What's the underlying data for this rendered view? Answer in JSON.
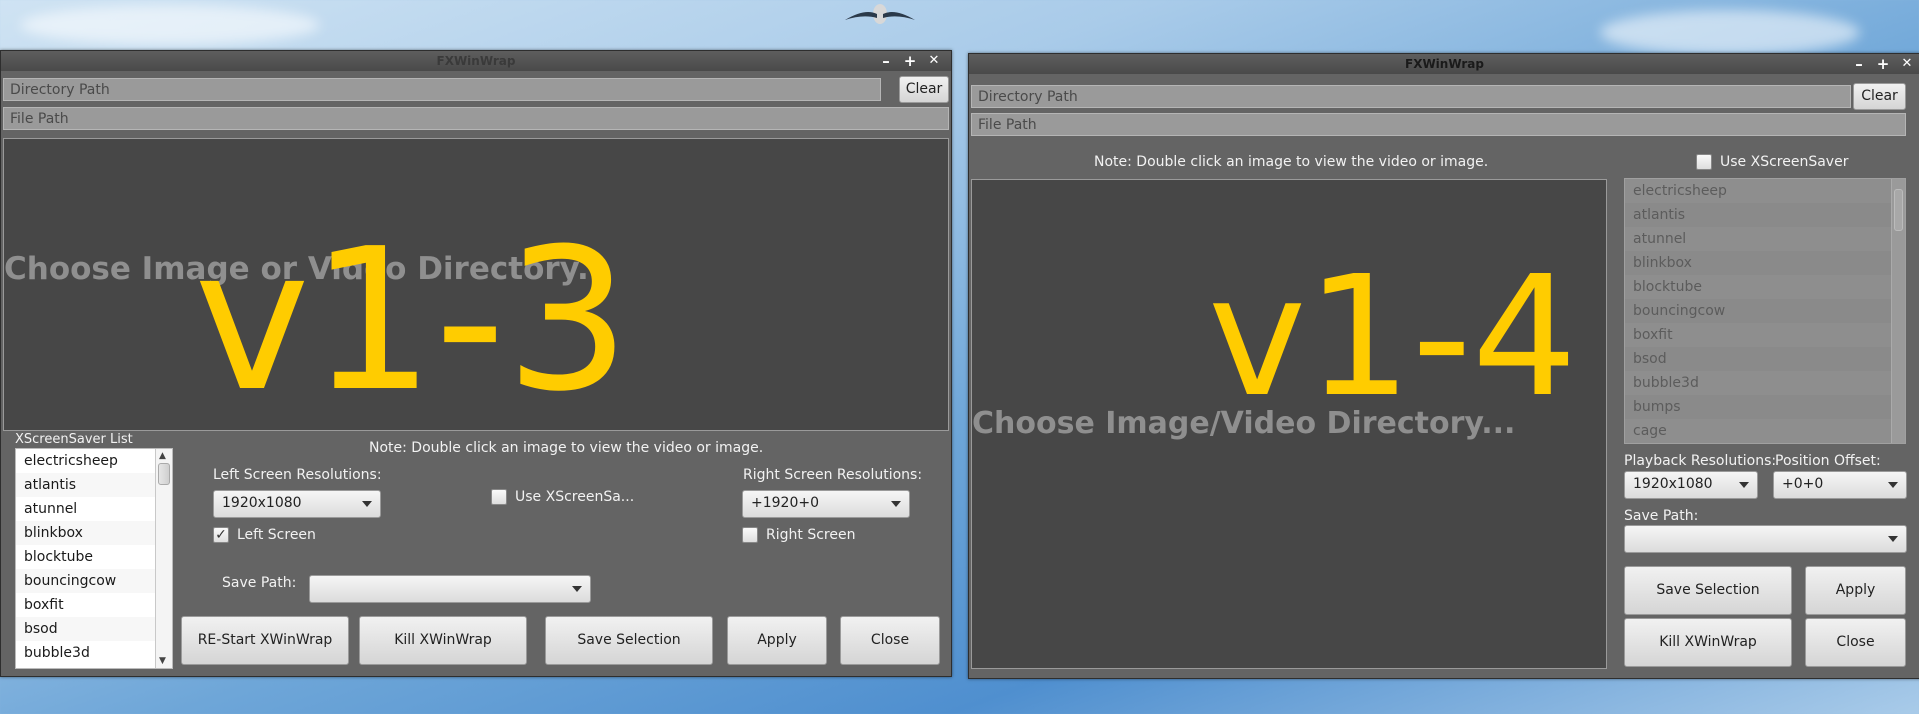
{
  "left_window": {
    "title": "FXWinWrap",
    "version_label": "v1-3",
    "directory_path_placeholder": "Directory Path",
    "file_path_placeholder": "File Path",
    "clear_label": "Clear",
    "preview_placeholder": "Choose Image or Video Directory...",
    "list_title": "XScreenSaver List",
    "note": "Note: Double click an image to view the video or image.",
    "left_res_label": "Left Screen Resolutions:",
    "left_res_value": "1920x1080",
    "use_xscreensaver_label": "Use XScreenSa...",
    "use_xscreensaver_checked": false,
    "right_res_label": "Right Screen Resolutions:",
    "right_res_value": "+1920+0",
    "left_screen_label": "Left Screen",
    "left_screen_checked": true,
    "right_screen_label": "Right Screen",
    "right_screen_checked": false,
    "save_path_label": "Save Path:",
    "save_path_value": "",
    "buttons": {
      "restart": "RE-Start XWinWrap",
      "kill": "Kill XWinWrap",
      "save_selection": "Save Selection",
      "apply": "Apply",
      "close": "Close"
    },
    "screensavers": [
      "electricsheep",
      "atlantis",
      "atunnel",
      "blinkbox",
      "blocktube",
      "bouncingcow",
      "boxfit",
      "bsod",
      "bubble3d"
    ]
  },
  "right_window": {
    "title": "FXWinWrap",
    "version_label": "v1-4",
    "directory_path_placeholder": "Directory Path",
    "file_path_placeholder": "File Path",
    "clear_label": "Clear",
    "note": "Note: Double click an image to view the video or image.",
    "preview_placeholder": "Choose Image/Video Directory...",
    "use_xscreensaver_label": "Use XScreenSaver",
    "use_xscreensaver_checked": false,
    "screensavers": [
      "electricsheep",
      "atlantis",
      "atunnel",
      "blinkbox",
      "blocktube",
      "bouncingcow",
      "boxfit",
      "bsod",
      "bubble3d",
      "bumps",
      "cage"
    ],
    "playback_res_label": "Playback Resolutions:",
    "playback_res_value": "1920x1080",
    "position_offset_label": "Position Offset:",
    "position_offset_value": "+0+0",
    "save_path_label": "Save Path:",
    "save_path_value": "",
    "buttons": {
      "save_selection": "Save Selection",
      "apply": "Apply",
      "kill": "Kill XWinWrap",
      "close": "Close"
    }
  },
  "window_controls": {
    "minimize": "–",
    "maximize": "+",
    "close": "✕"
  },
  "colors": {
    "accent_version": "#ffcc00",
    "window_bg": "#646464",
    "preview_bg": "#474747"
  }
}
